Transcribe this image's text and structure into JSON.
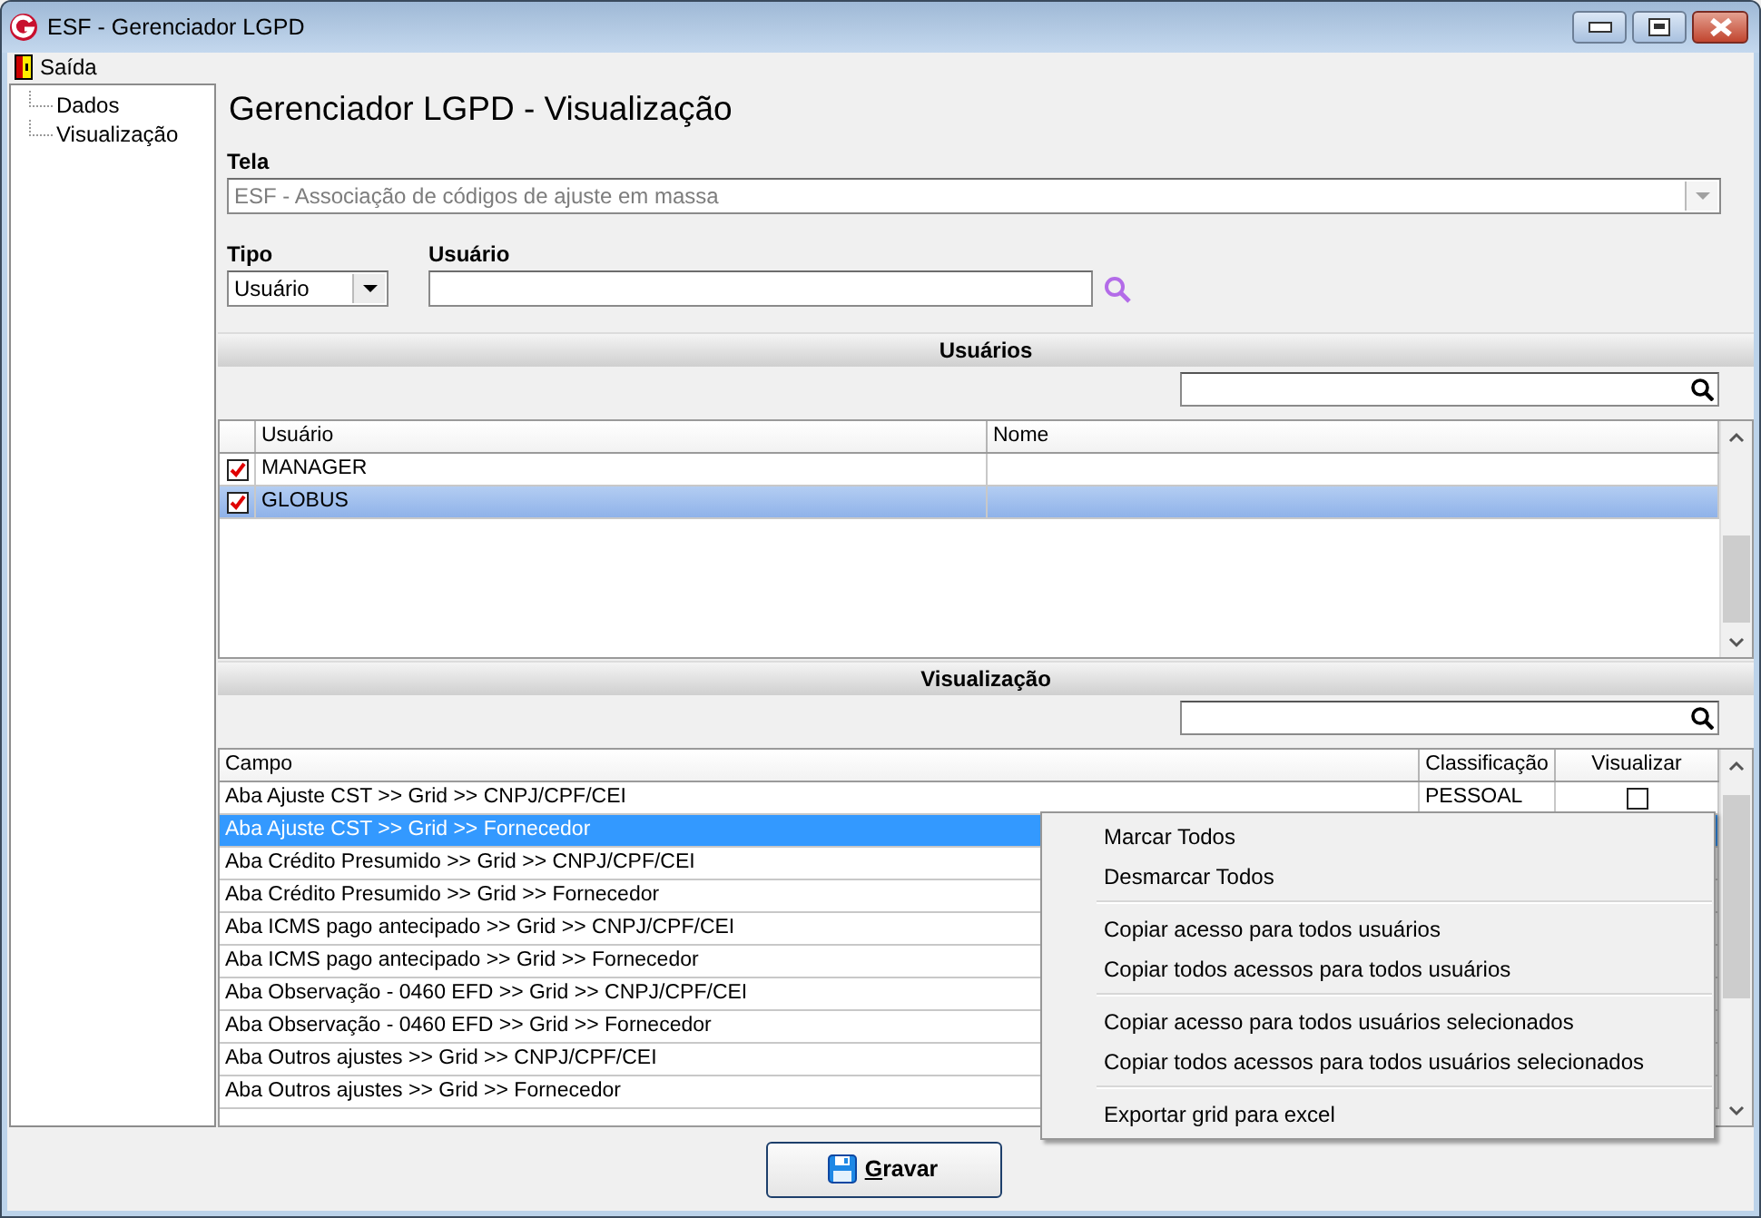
{
  "window": {
    "title": "ESF - Gerenciador LGPD"
  },
  "menu": [
    {
      "label": "Saída"
    }
  ],
  "tree": [
    {
      "label": "Dados"
    },
    {
      "label": "Visualização"
    }
  ],
  "heading": "Gerenciador LGPD - Visualização",
  "tela": {
    "label": "Tela",
    "value": "ESF - Associação de códigos de ajuste em massa",
    "disabled": true
  },
  "tipo": {
    "label": "Tipo",
    "value": "Usuário"
  },
  "usuario": {
    "label": "Usuário"
  },
  "usuarios_panel": {
    "title": "Usuários",
    "columns": [
      "Usuário",
      "Nome"
    ],
    "rows": [
      {
        "usuario": "MANAGER",
        "checked": true,
        "selected": false
      },
      {
        "usuario": "GLOBUS",
        "checked": true,
        "selected": true
      }
    ]
  },
  "visualizacao_panel": {
    "title": "Visualização",
    "columns": [
      "Campo",
      "Classificação",
      "Visualizar"
    ],
    "rows": [
      {
        "campo": "Aba Ajuste CST >> Grid >> CNPJ/CPF/CEI",
        "classificacao": "PESSOAL",
        "visualizar": false,
        "selected": false
      },
      {
        "campo": "Aba Ajuste CST >> Grid >> Fornecedor",
        "selected": true
      },
      {
        "campo": "Aba Crédito Presumido >> Grid >> CNPJ/CPF/CEI",
        "selected": false
      },
      {
        "campo": "Aba Crédito Presumido >> Grid >> Fornecedor",
        "selected": false
      },
      {
        "campo": "Aba ICMS pago antecipado >> Grid >> CNPJ/CPF/CEI",
        "selected": false
      },
      {
        "campo": "Aba ICMS pago antecipado >> Grid >> Fornecedor",
        "selected": false
      },
      {
        "campo": "Aba Observação - 0460 EFD >> Grid >> CNPJ/CPF/CEI",
        "selected": false
      },
      {
        "campo": "Aba Observação - 0460 EFD >> Grid >> Fornecedor",
        "selected": false
      },
      {
        "campo": "Aba Outros ajustes >> Grid >> CNPJ/CPF/CEI",
        "selected": false
      },
      {
        "campo": "Aba Outros ajustes >> Grid >> Fornecedor",
        "selected": false
      }
    ]
  },
  "context_menu": [
    {
      "kind": "item",
      "label": "Marcar Todos"
    },
    {
      "kind": "item",
      "label": "Desmarcar Todos"
    },
    {
      "kind": "separator"
    },
    {
      "kind": "item",
      "label": "Copiar acesso para todos usuários"
    },
    {
      "kind": "item",
      "label": "Copiar todos acessos para todos usuários"
    },
    {
      "kind": "separator"
    },
    {
      "kind": "item",
      "label": "Copiar acesso para todos usuários selecionados"
    },
    {
      "kind": "item",
      "label": "Copiar todos acessos para todos usuários selecionados"
    },
    {
      "kind": "separator"
    },
    {
      "kind": "item",
      "label": "Exportar grid para excel"
    }
  ],
  "save_button": {
    "label": "Gravar"
  }
}
